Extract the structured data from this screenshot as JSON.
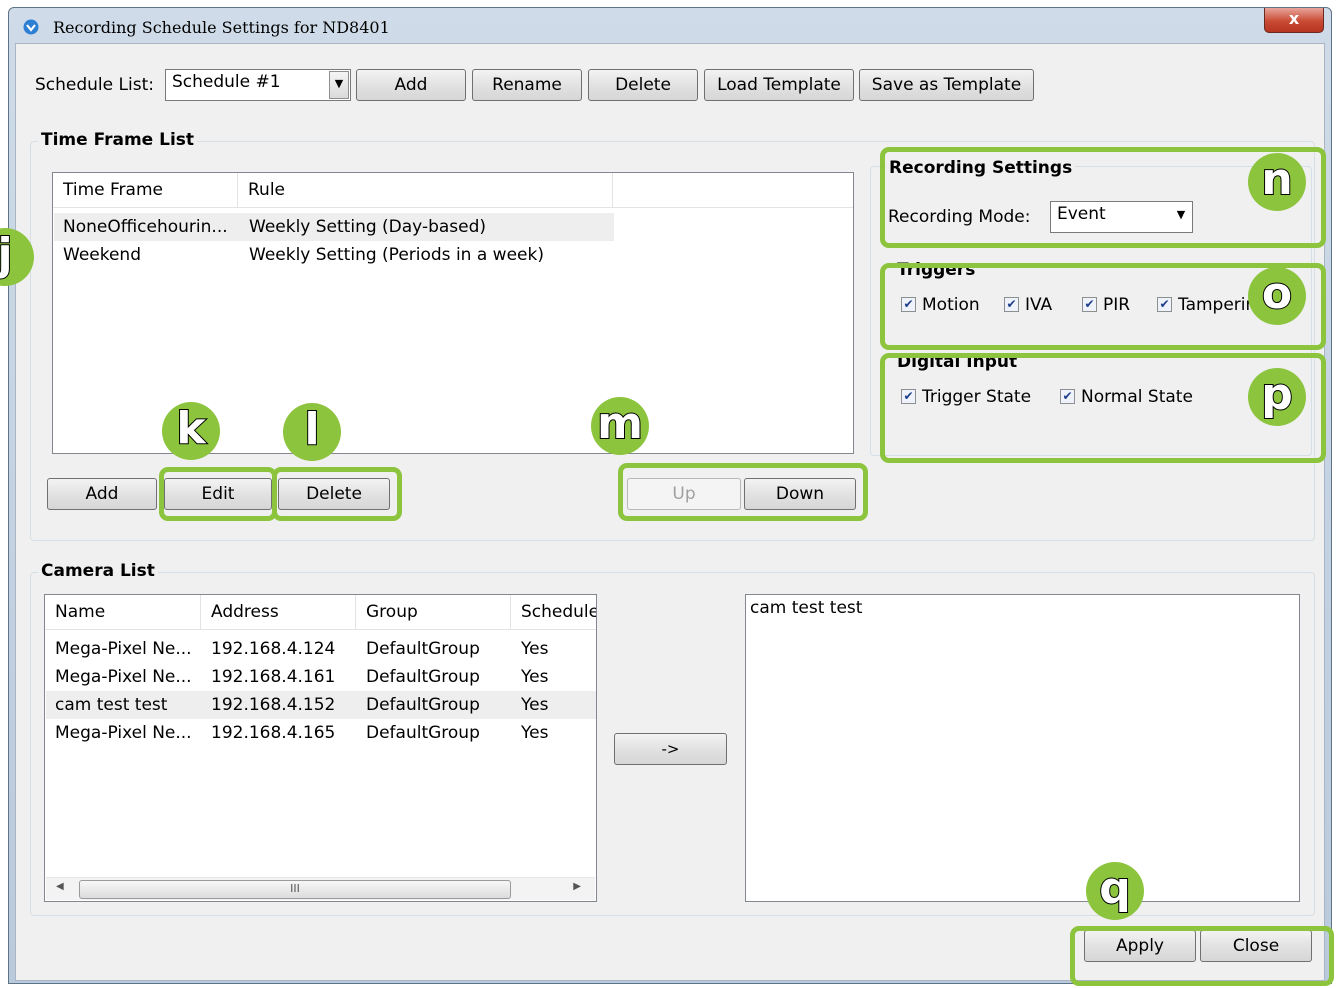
{
  "window": {
    "title": "Recording Schedule Settings for ND8401",
    "close_label": "x"
  },
  "schedule": {
    "label": "Schedule List:",
    "selected": "Schedule #1",
    "buttons": {
      "add": "Add",
      "rename": "Rename",
      "delete": "Delete",
      "load_template": "Load Template",
      "save_template": "Save as Template"
    }
  },
  "time_frame": {
    "title": "Time Frame List",
    "columns": [
      "Time Frame",
      "Rule"
    ],
    "rows": [
      {
        "name": "NoneOfficehourin...",
        "rule": "Weekly Setting (Day-based)"
      },
      {
        "name": "Weekend",
        "rule": "Weekly Setting (Periods in a week)"
      }
    ],
    "buttons": {
      "add": "Add",
      "edit": "Edit",
      "delete": "Delete",
      "up": "Up",
      "down": "Down"
    }
  },
  "recording": {
    "title": "Recording Settings",
    "mode_label": "Recording Mode:",
    "mode_value": "Event"
  },
  "triggers": {
    "title": "Triggers",
    "items": [
      "Motion",
      "IVA",
      "PIR",
      "Tamperin"
    ]
  },
  "digital_input": {
    "title": "Digital Input",
    "items": [
      "Trigger State",
      "Normal State"
    ]
  },
  "camera": {
    "title": "Camera List",
    "columns": [
      "Name",
      "Address",
      "Group",
      "Schedule"
    ],
    "rows": [
      {
        "name": "Mega-Pixel Ne...",
        "address": "192.168.4.124",
        "group": "DefaultGroup",
        "schedule": "Yes"
      },
      {
        "name": "Mega-Pixel Ne...",
        "address": "192.168.4.161",
        "group": "DefaultGroup",
        "schedule": "Yes"
      },
      {
        "name": "cam test test",
        "address": "192.168.4.152",
        "group": "DefaultGroup",
        "schedule": "Yes"
      },
      {
        "name": "Mega-Pixel Ne...",
        "address": "192.168.4.165",
        "group": "DefaultGroup",
        "schedule": "Yes"
      }
    ],
    "scroll_thumb_grip": "III",
    "move_button": "->",
    "selected_list": [
      "cam test test"
    ]
  },
  "footer": {
    "apply": "Apply",
    "close": "Close"
  },
  "callouts": {
    "j": "j",
    "k": "k",
    "l": "l",
    "m": "m",
    "n": "n",
    "o": "o",
    "p": "p",
    "q": "q"
  },
  "colors": {
    "highlight": "#8cc43e",
    "selected_row": "#eeeeee"
  }
}
